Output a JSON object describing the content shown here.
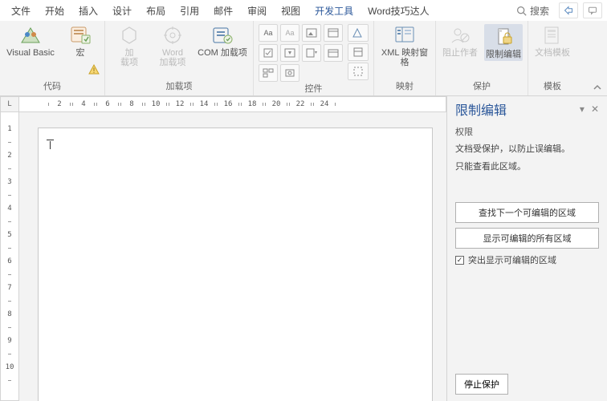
{
  "tabs": {
    "file": "文件",
    "home": "开始",
    "insert": "插入",
    "design": "设计",
    "layout": "布局",
    "references": "引用",
    "mailings": "邮件",
    "review": "审阅",
    "view": "视图",
    "developer": "开发工具",
    "tips": "Word技巧达人"
  },
  "search": {
    "label": "搜索"
  },
  "ribbon": {
    "code": {
      "label": "代码",
      "visual_basic": "Visual Basic",
      "macros": "宏"
    },
    "addins": {
      "label": "加载项",
      "addins": "加\n载项",
      "word_addins": "Word\n加载项",
      "com_addins": "COM 加载项"
    },
    "controls": {
      "label": "控件"
    },
    "mapping": {
      "label": "映射",
      "xml_panel": "XML 映射窗格"
    },
    "protect": {
      "label": "保护",
      "block_authors": "阻止作者",
      "restrict_editing": "限制编辑"
    },
    "templates": {
      "label": "模板",
      "doc_template": "文档模板"
    }
  },
  "ruler": {
    "corner": "L",
    "h_numbers": [
      "2",
      "4",
      "6",
      "8",
      "10",
      "12",
      "14",
      "16",
      "18",
      "20",
      "22",
      "24"
    ],
    "v_numbers": [
      "1",
      "2",
      "3",
      "4",
      "5",
      "6",
      "7",
      "8",
      "9",
      "10"
    ]
  },
  "panel": {
    "title": "限制编辑",
    "close": "✕",
    "dropdown": "▾",
    "section": "权限",
    "line1": "文档受保护，以防止误编辑。",
    "line2": "只能查看此区域。",
    "find_next": "查找下一个可编辑的区域",
    "show_all": "显示可编辑的所有区域",
    "highlight": "突出显示可编辑的区域",
    "stop": "停止保护"
  }
}
